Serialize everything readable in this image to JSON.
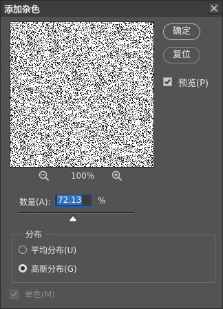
{
  "window": {
    "title": "添加杂色"
  },
  "buttons": {
    "ok_label": "确定",
    "reset_label": "复位"
  },
  "preview_option": {
    "label": "预览(P)",
    "checked": true
  },
  "zoom": {
    "level": "100%"
  },
  "amount": {
    "label": "数量(A):",
    "value": "72.13",
    "unit": "%"
  },
  "distribution": {
    "group_label": "分布",
    "options": [
      {
        "label": "平均分布(U)",
        "selected": false
      },
      {
        "label": "高斯分布(G)",
        "selected": true
      }
    ]
  },
  "monochromatic": {
    "label": "单色(M)",
    "checked": true,
    "disabled": true
  },
  "icons": {
    "close": "close-icon",
    "zoom_out": "zoom-out-icon",
    "zoom_in": "zoom-in-icon",
    "check": "checkmark-icon"
  },
  "colors": {
    "panel": "#535353",
    "titlebar": "#3d3d3d",
    "selection": "#2f6fc4"
  }
}
